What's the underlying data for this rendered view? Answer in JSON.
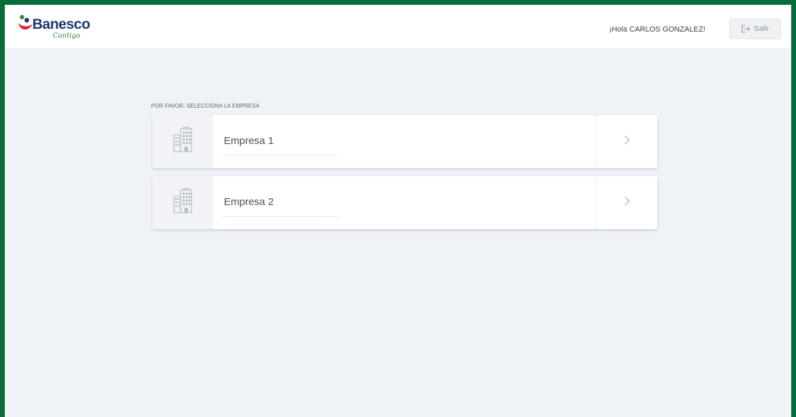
{
  "brand": {
    "name": "Banesco",
    "tagline": "Contigo",
    "colors": {
      "blue": "#1b3a6b",
      "red": "#e0242d",
      "green": "#2e8a3c",
      "frame": "#0a6b3a"
    }
  },
  "header": {
    "greeting": "¡Hola CARLOS GONZALEZ!",
    "logout_label": "Salir",
    "logout_icon": "logout-icon"
  },
  "main": {
    "prompt": "POR FAVOR, SELECCIONA LA EMPRESA",
    "companies": [
      {
        "name": "Empresa 1",
        "icon": "building-icon",
        "action_icon": "chevron-right-icon"
      },
      {
        "name": "Empresa 2",
        "icon": "building-icon",
        "action_icon": "chevron-right-icon"
      }
    ]
  }
}
